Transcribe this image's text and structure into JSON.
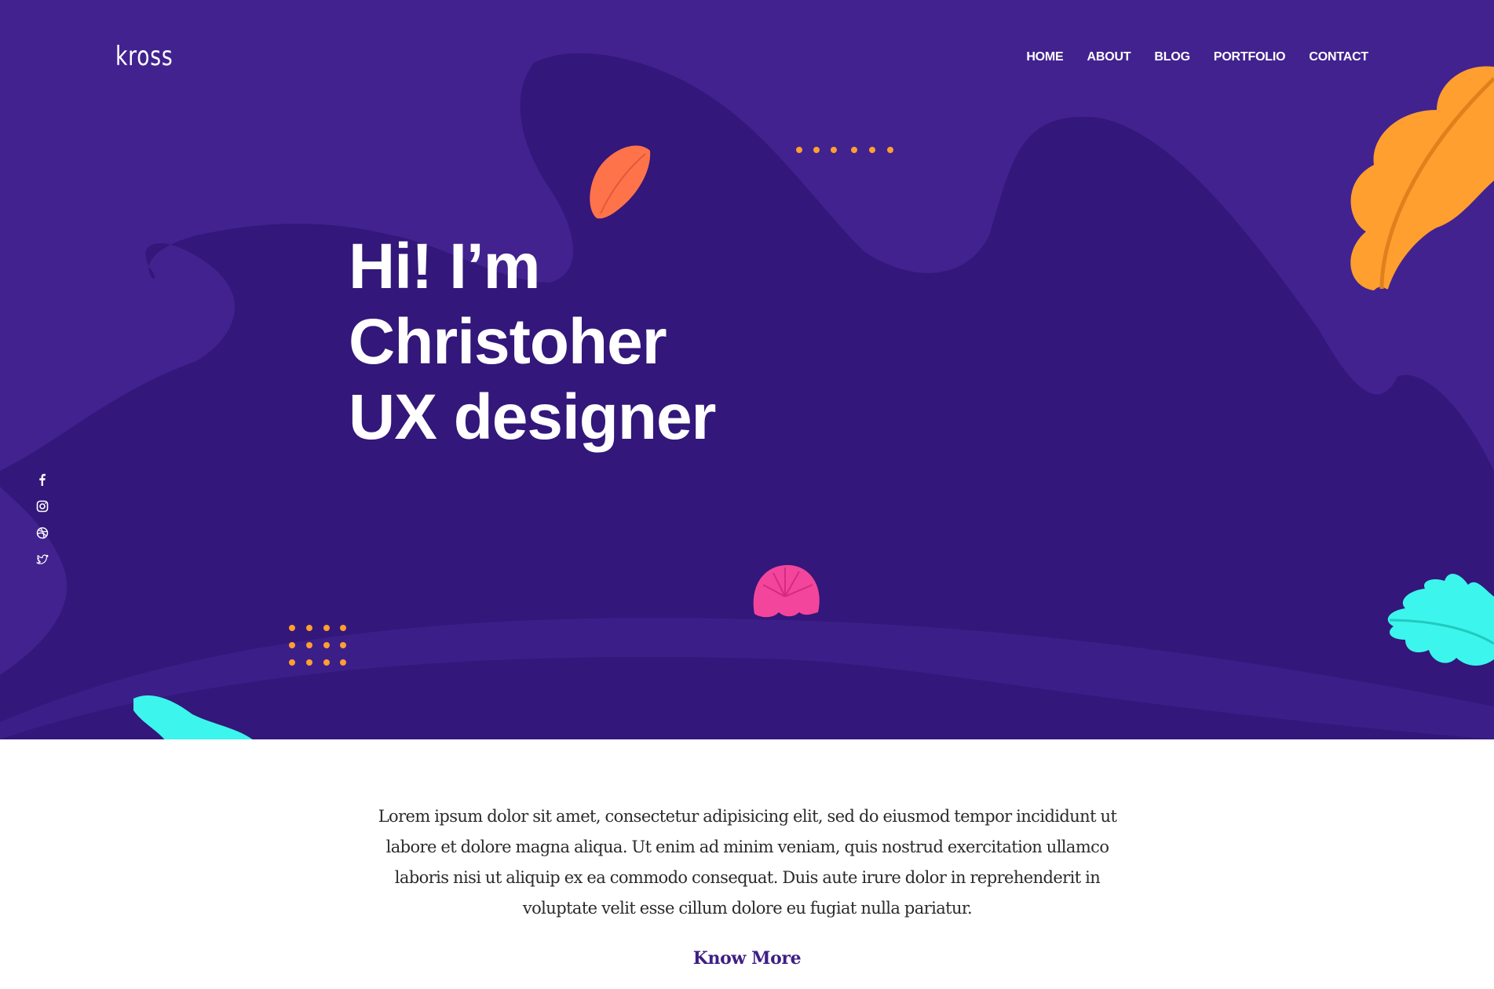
{
  "brand": {
    "logo_text": "kross"
  },
  "nav": {
    "items": [
      {
        "label": "HOME"
      },
      {
        "label": "ABOUT"
      },
      {
        "label": "BLOG"
      },
      {
        "label": "PORTFOLIO"
      },
      {
        "label": "CONTACT"
      }
    ]
  },
  "hero": {
    "title_lines": [
      "Hi! I’m",
      "Christoher",
      "UX designer"
    ]
  },
  "social": {
    "icons": [
      "facebook-icon",
      "instagram-icon",
      "dribbble-icon",
      "twitter-icon"
    ]
  },
  "intro": {
    "paragraph": "Lorem ipsum dolor sit amet, consectetur adipisicing elit, sed do eiusmod tempor incididunt ut labore et dolore magna aliqua. Ut enim ad minim veniam, quis nostrud exercitation ullamco laboris nisi ut aliquip ex ea commodo consequat. Duis aute irure dolor in reprehenderit in voluptate velit esse cillum dolore eu fugiat nulla pariatur.",
    "cta_label": "Know More"
  },
  "colors": {
    "hero_bg": "#42228f",
    "hero_blob": "#33177a",
    "accent_orange": "#ff9f2f",
    "accent_coral": "#ff734b",
    "accent_pink": "#f3459b",
    "accent_cyan": "#3cf5ec",
    "link_purple": "#3e1f84"
  }
}
